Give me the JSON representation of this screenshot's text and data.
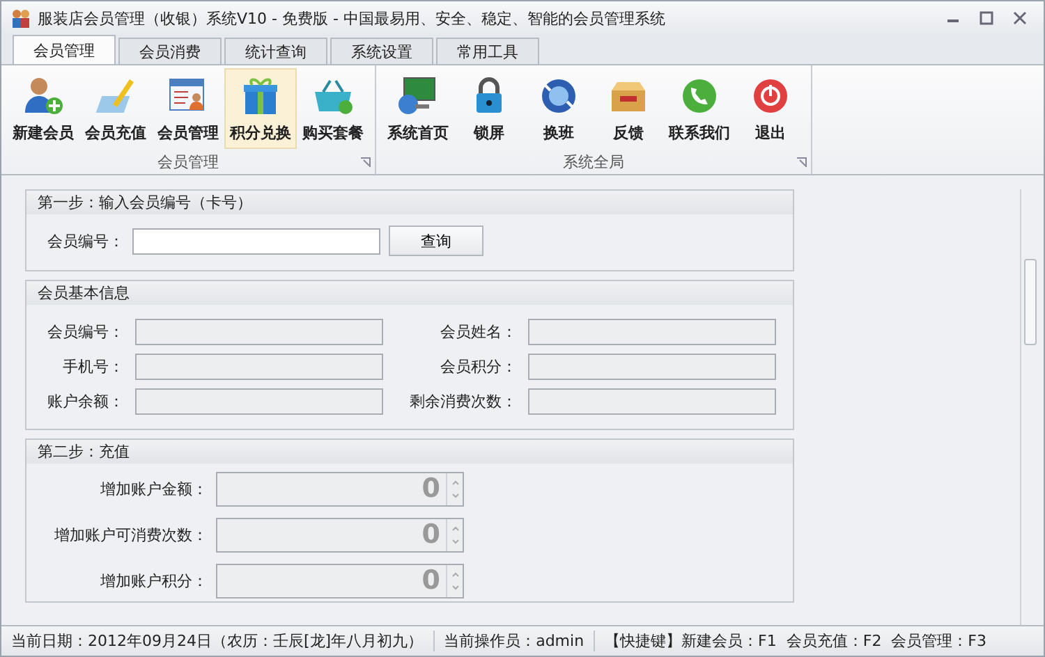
{
  "window": {
    "title": "服装店会员管理（收银）系统V10 - 免费版 - 中国最易用、安全、稳定、智能的会员管理系统"
  },
  "tabs": [
    {
      "label": "会员管理",
      "selected": true
    },
    {
      "label": "会员消费",
      "selected": false
    },
    {
      "label": "统计查询",
      "selected": false
    },
    {
      "label": "系统设置",
      "selected": false
    },
    {
      "label": "常用工具",
      "selected": false
    }
  ],
  "ribbon_groups": [
    {
      "label": "会员管理",
      "buttons": [
        {
          "label": "新建会员",
          "kind": "user-add",
          "selected": false
        },
        {
          "label": "会员充值",
          "kind": "pen",
          "selected": false
        },
        {
          "label": "会员管理",
          "kind": "card",
          "selected": false
        },
        {
          "label": "积分兑换",
          "kind": "gift",
          "selected": true
        },
        {
          "label": "购买套餐",
          "kind": "basket",
          "selected": false
        }
      ]
    },
    {
      "label": "系统全局",
      "buttons": [
        {
          "label": "系统首页",
          "kind": "monitor",
          "selected": false
        },
        {
          "label": "锁屏",
          "kind": "lock",
          "selected": false
        },
        {
          "label": "换班",
          "kind": "refresh",
          "selected": false
        },
        {
          "label": "反馈",
          "kind": "box",
          "selected": false
        },
        {
          "label": "联系我们",
          "kind": "phone",
          "selected": false
        },
        {
          "label": "退出",
          "kind": "power",
          "selected": false
        }
      ]
    }
  ],
  "step1": {
    "title": "第一步：输入会员编号（卡号）",
    "label": "会员编号：",
    "button": "查询"
  },
  "member_info": {
    "title": "会员基本信息",
    "fields": [
      {
        "label": "会员编号："
      },
      {
        "label": "会员姓名："
      },
      {
        "label": "手机号："
      },
      {
        "label": "会员积分："
      },
      {
        "label": "账户余额："
      },
      {
        "label": "剩余消费次数："
      }
    ]
  },
  "step2": {
    "title": "第二步：充值",
    "fields": [
      {
        "label": "增加账户金额：",
        "value": "0"
      },
      {
        "label": "增加账户可消费次数：",
        "value": "0"
      },
      {
        "label": "增加账户积分：",
        "value": "0"
      }
    ]
  },
  "status_bar": [
    "当前日期：2012年09月24日（农历：壬辰[龙]年八月初九）",
    "当前操作员：admin",
    "【快捷键】新建会员：F1  会员充值：F2  会员管理：F3"
  ]
}
